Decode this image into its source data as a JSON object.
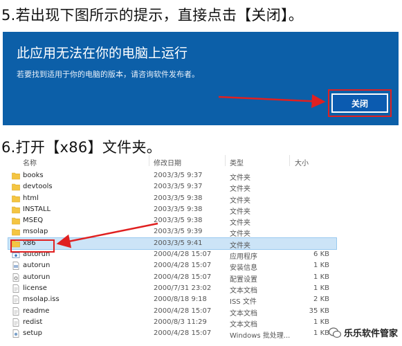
{
  "step5": {
    "text": "5.若出现下图所示的提示，直接点击【关闭】。"
  },
  "dialog": {
    "title": "此应用无法在你的电脑上运行",
    "message": "若要找到适用于你的电脑的版本，请咨询软件发布者。",
    "close_label": "关闭",
    "bg_color": "#0c5fa8"
  },
  "step6": {
    "text": "6.打开【x86】文件夹。"
  },
  "explorer": {
    "columns": {
      "name": "名称",
      "date": "修改日期",
      "type": "类型",
      "size": "大小"
    },
    "rows": [
      {
        "icon": "folder-icon",
        "name": "books",
        "date": "2003/3/5 9:37",
        "type": "文件夹",
        "size": ""
      },
      {
        "icon": "folder-icon",
        "name": "devtools",
        "date": "2003/3/5 9:37",
        "type": "文件夹",
        "size": ""
      },
      {
        "icon": "folder-icon",
        "name": "html",
        "date": "2003/3/5 9:38",
        "type": "文件夹",
        "size": ""
      },
      {
        "icon": "folder-icon",
        "name": "INSTALL",
        "date": "2003/3/5 9:38",
        "type": "文件夹",
        "size": ""
      },
      {
        "icon": "folder-icon",
        "name": "MSEQ",
        "date": "2003/3/5 9:38",
        "type": "文件夹",
        "size": ""
      },
      {
        "icon": "folder-icon",
        "name": "msolap",
        "date": "2003/3/5 9:39",
        "type": "文件夹",
        "size": ""
      },
      {
        "icon": "folder-icon",
        "name": "x86",
        "date": "2003/3/5 9:41",
        "type": "文件夹",
        "size": "",
        "selected": true
      },
      {
        "icon": "app-icon",
        "name": "autorun",
        "date": "2000/4/28 15:07",
        "type": "应用程序",
        "size": "6 KB"
      },
      {
        "icon": "setup-info-icon",
        "name": "autorun",
        "date": "2000/4/28 15:07",
        "type": "安装信息",
        "size": "1 KB"
      },
      {
        "icon": "config-icon",
        "name": "autorun",
        "date": "2000/4/28 15:07",
        "type": "配置设置",
        "size": "1 KB"
      },
      {
        "icon": "document-icon",
        "name": "license",
        "date": "2000/7/31 23:02",
        "type": "文本文档",
        "size": "1 KB"
      },
      {
        "icon": "document-icon",
        "name": "msolap.iss",
        "date": "2000/8/18 9:18",
        "type": "ISS 文件",
        "size": "2 KB"
      },
      {
        "icon": "document-icon",
        "name": "readme",
        "date": "2000/4/28 15:07",
        "type": "文本文档",
        "size": "35 KB"
      },
      {
        "icon": "document-icon",
        "name": "redist",
        "date": "2000/8/3 11:29",
        "type": "文本文档",
        "size": "1 KB"
      },
      {
        "icon": "batch-icon",
        "name": "setup",
        "date": "2000/4/28 15:07",
        "type": "Windows 批处理...",
        "size": "1 KB"
      }
    ]
  },
  "watermark": {
    "text": "乐乐软件管家"
  },
  "colors": {
    "highlight_red": "#e02020",
    "selection_blue": "#cce4f7",
    "folder_yellow": "#f4c542"
  }
}
